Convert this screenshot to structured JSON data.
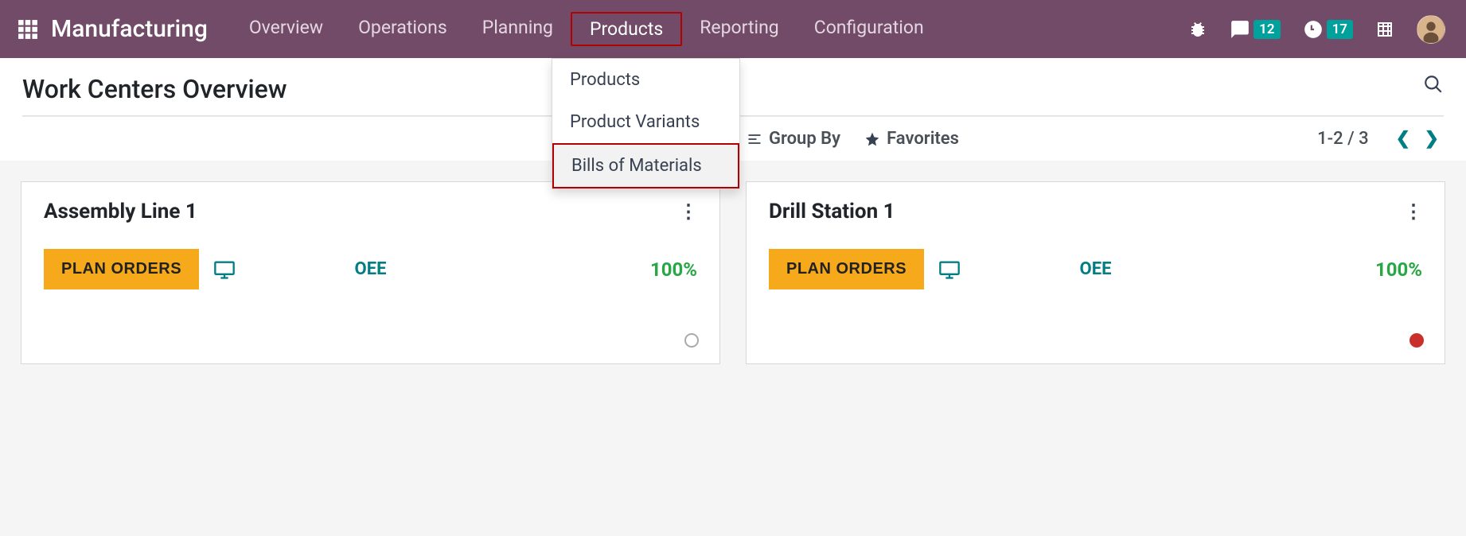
{
  "app_title": "Manufacturing",
  "main_menu": [
    "Overview",
    "Operations",
    "Planning",
    "Products",
    "Reporting",
    "Configuration"
  ],
  "active_menu_index": 3,
  "nav": {
    "messages_count": "12",
    "activities_count": "17"
  },
  "dropdown": {
    "items": [
      "Products",
      "Product Variants",
      "Bills of Materials"
    ],
    "highlight_index": 2
  },
  "page_title": "Work Centers Overview",
  "controls": {
    "groupby": "Group By",
    "favorites": "Favorites",
    "pager": "1-2 / 3"
  },
  "cards": [
    {
      "title": "Assembly Line 1",
      "plan_label": "PLAN ORDERS",
      "oee_label": "OEE",
      "oee_value": "100%",
      "status": "grey"
    },
    {
      "title": "Drill Station 1",
      "plan_label": "PLAN ORDERS",
      "oee_label": "OEE",
      "oee_value": "100%",
      "status": "red"
    }
  ]
}
